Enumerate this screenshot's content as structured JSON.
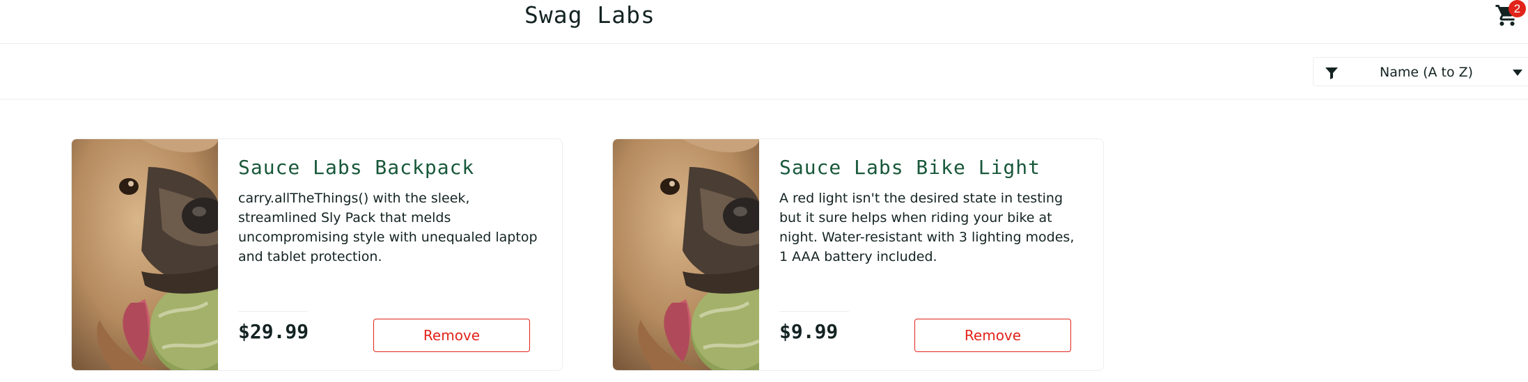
{
  "header": {
    "app_title": "Swag Labs",
    "cart_badge": "2",
    "cart_icon": "shopping-cart-icon"
  },
  "sort": {
    "selected": "Name (A to Z)",
    "filter_icon": "filter-icon",
    "caret_icon": "caret-down-icon"
  },
  "products": [
    {
      "name": "Sauce Labs Backpack",
      "description": "carry.allTheThings() with the sleek, streamlined Sly Pack that melds uncompromising style with unequaled laptop and tablet protection.",
      "price": "$29.99",
      "button": "Remove"
    },
    {
      "name": "Sauce Labs Bike Light",
      "description": "A red light isn't the desired state in testing but it sure helps when riding your bike at night. Water-resistant with 3 lighting modes, 1 AAA battery included.",
      "price": "$9.99",
      "button": "Remove"
    }
  ],
  "colors": {
    "accent_red": "#e2231a",
    "product_name_green": "#18583a",
    "text_dark": "#132322"
  }
}
